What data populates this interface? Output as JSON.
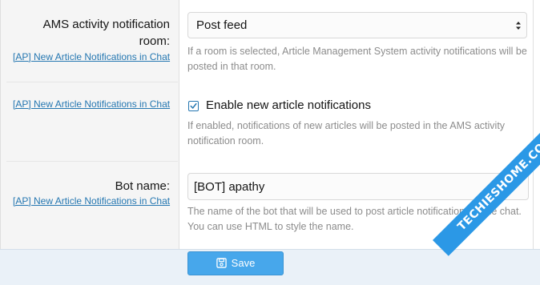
{
  "rows": [
    {
      "label_line1": "AMS activity notification",
      "label_line2": "room:",
      "hint": "[AP] New Article Notifications in Chat",
      "select_value": "Post feed",
      "explain": "If a room is selected, Article Management System activity notifications will be posted in that room."
    },
    {
      "hint": "[AP] New Article Notifications in Chat",
      "checkbox_label": "Enable new article notifications",
      "checked": true,
      "explain": "If enabled, notifications of new articles will be posted in the AMS activity notification room."
    },
    {
      "label": "Bot name:",
      "hint": "[AP] New Article Notifications in Chat",
      "input_value": "[BOT] apathy",
      "explain": "The name of the bot that will be used to post article notifications in the chat. You can use HTML to style the name."
    }
  ],
  "footer": {
    "save_label": "Save",
    "save_icon": "save-icon"
  },
  "watermark": {
    "text": "TECHIESHOME.COM"
  },
  "colors": {
    "link": "#2577b1",
    "button": "#47a7eb",
    "footer_bg": "#eaf1f8",
    "muted_text": "#8c8c8c"
  }
}
